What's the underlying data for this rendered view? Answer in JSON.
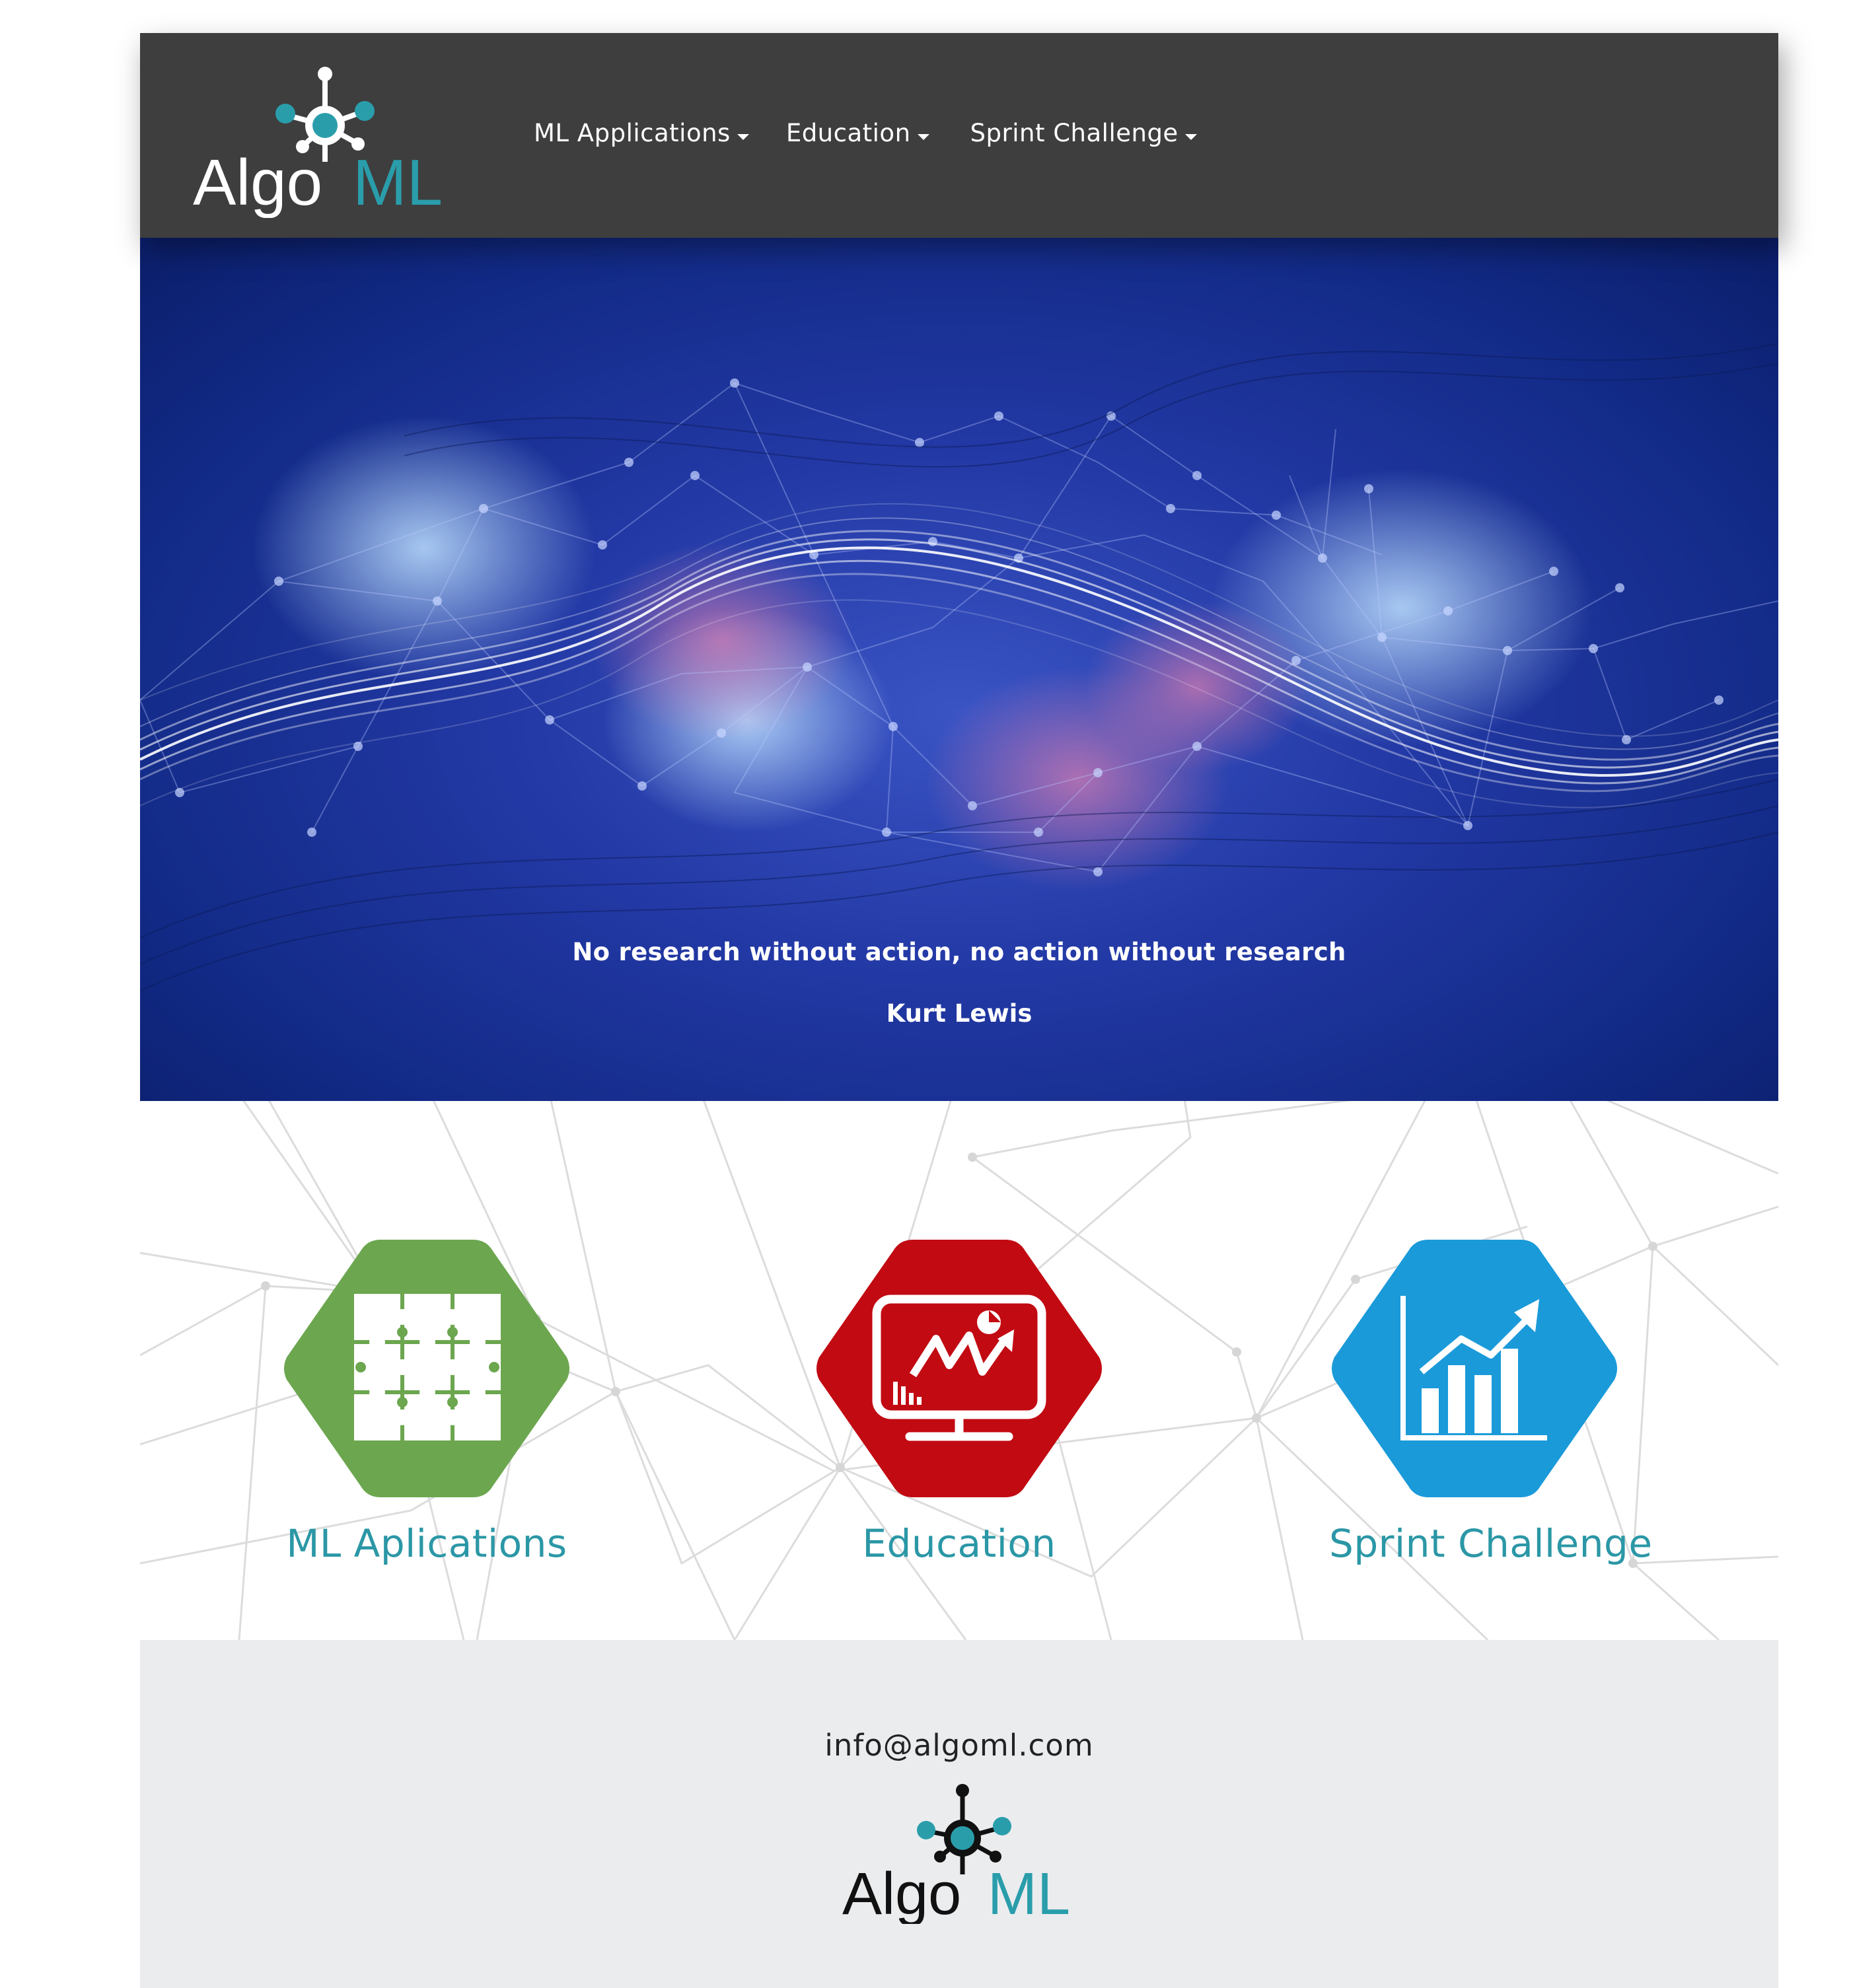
{
  "brand": {
    "name_part1": "Algo",
    "name_part2": "ML",
    "accent_color": "#2a9dab"
  },
  "nav": {
    "items": [
      {
        "label": "ML Applications"
      },
      {
        "label": "Education"
      },
      {
        "label": "Sprint Challenge"
      }
    ]
  },
  "hero": {
    "quote": "No research without action, no action without research",
    "author": "Kurt Lewis"
  },
  "features": [
    {
      "label": "ML Aplications",
      "color": "#6ca64f",
      "icon": "puzzle-icon"
    },
    {
      "label": "Education",
      "color": "#c20a12",
      "icon": "monitor-chart-icon"
    },
    {
      "label": "Sprint Challenge",
      "color": "#1a9ad9",
      "icon": "bar-chart-growth-icon"
    }
  ],
  "footer": {
    "email": "info@algoml.com"
  }
}
